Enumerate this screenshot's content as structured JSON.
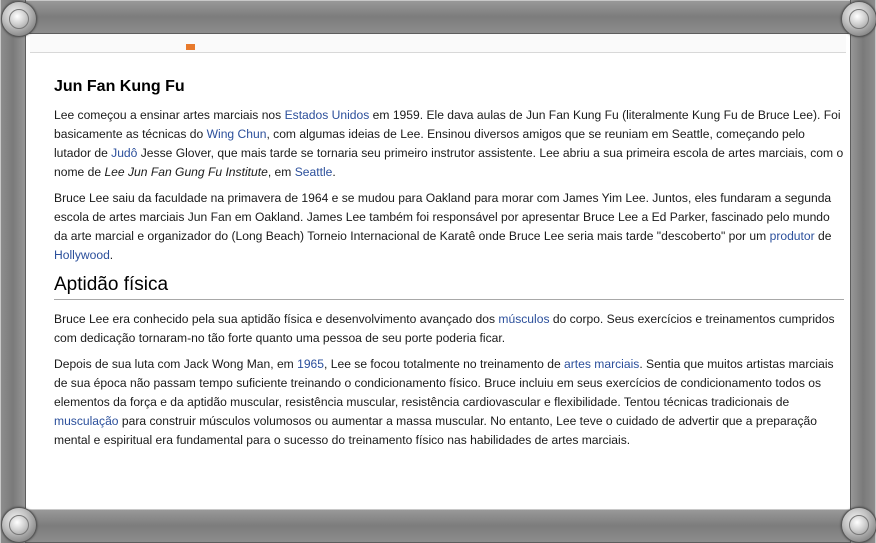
{
  "heading_kung_fu": "Jun Fan Kung Fu",
  "p1": {
    "t1": "Lee começou a ensinar artes marciais nos ",
    "l1": "Estados Unidos",
    "t2": " em 1959. Ele dava aulas de Jun Fan Kung Fu (literalmente Kung Fu de Bruce Lee). Foi basicamente as técnicas do ",
    "l2": "Wing Chun",
    "t3": ", com algumas ideias de Lee. Ensinou diversos amigos que se reuniam em Seattle, começando pelo lutador de ",
    "l3": "Judô",
    "t4": " Jesse Glover, que mais tarde se tornaria seu primeiro instrutor assistente. Lee abriu a sua primeira escola de artes marciais, com o nome de ",
    "em1": "Lee Jun Fan Gung Fu Institute",
    "t5": ", em ",
    "l4": "Seattle",
    "t6": "."
  },
  "p2": {
    "t1": "Bruce Lee saiu da faculdade na primavera de 1964 e se mudou para Oakland para morar com James Yim Lee. Juntos, eles fundaram a segunda escola de artes marciais Jun Fan em Oakland. James Lee também foi responsável por apresentar Bruce Lee a Ed Parker, fascinado pelo mundo da arte marcial e organizador do (Long Beach) Torneio Internacional de Karatê onde Bruce Lee seria mais tarde \"descoberto\" por um ",
    "l1": "produtor",
    "t2": " de ",
    "l2": "Hollywood",
    "t3": "."
  },
  "heading_aptidao": "Aptidão física",
  "p3": {
    "t1": "Bruce Lee era conhecido pela sua aptidão física e desenvolvimento avançado dos ",
    "l1": "músculos",
    "t2": " do corpo. Seus exercícios e treinamentos cumpridos com dedicação tornaram-no tão forte quanto uma pessoa de seu porte poderia ficar."
  },
  "p4": {
    "t1": "Depois de sua luta com Jack Wong Man, em ",
    "l1": "1965",
    "t2": ", Lee se focou totalmente no treinamento de ",
    "l2": "artes marciais",
    "t3": ". Sentia que muitos artistas marciais de sua época não passam tempo suficiente treinando o condicionamento físico. Bruce incluiu em seus exercícios de condicionamento todos os elementos da força e da aptidão muscular, resistência muscular, resistência cardiovascular e flexibilidade. Tentou técnicas tradicionais de ",
    "l3": "musculação",
    "t4": " para construir músculos volumosos ou aumentar a massa muscular. No entanto, Lee teve o cuidado de advertir que a preparação mental e espiritual era fundamental para o sucesso do treinamento físico nas habilidades de artes marciais."
  },
  "colors": {
    "link": "#2b4f9b",
    "frame": "#8a8a8a",
    "accent_tab": "#e87a2c"
  }
}
